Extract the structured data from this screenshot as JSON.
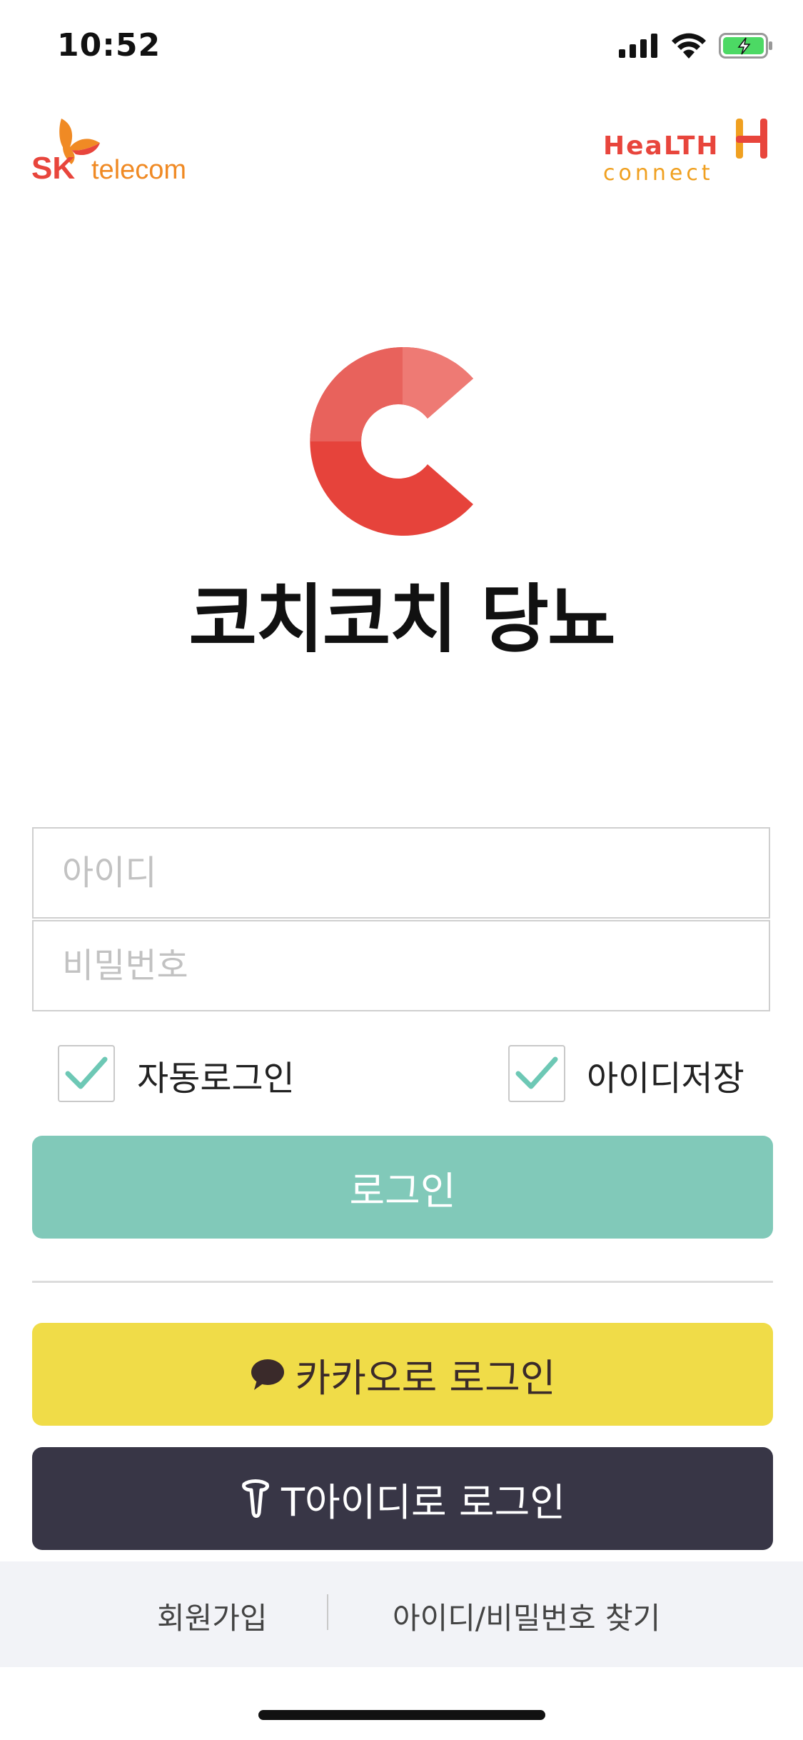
{
  "status_bar": {
    "time": "10:52",
    "icons": [
      "signal-icon",
      "wifi-icon",
      "battery-charging-icon"
    ]
  },
  "header": {
    "left_logo": {
      "line1": "SK",
      "line2": "telecom"
    },
    "right_logo": {
      "line1": "HeaLTH",
      "line2": "connect"
    }
  },
  "app": {
    "title": "코치코치 당뇨",
    "logo_icon": "coach-c-logo-icon"
  },
  "form": {
    "id_placeholder": "아이디",
    "password_placeholder": "비밀번호",
    "auto_login_label": "자동로그인",
    "save_id_label": "아이디저장",
    "auto_login_checked": true,
    "save_id_checked": true,
    "login_label": "로그인"
  },
  "social": {
    "kakao_label": "카카오로 로그인",
    "tid_label": "T아이디로 로그인"
  },
  "footer": {
    "signup_label": "회원가입",
    "find_label": "아이디/비밀번호 찾기"
  },
  "colors": {
    "login": "#81c9b9",
    "kakao": "#f0dc48",
    "tid": "#383646",
    "brand_red": "#e8453c",
    "check": "#6dc8b5"
  }
}
